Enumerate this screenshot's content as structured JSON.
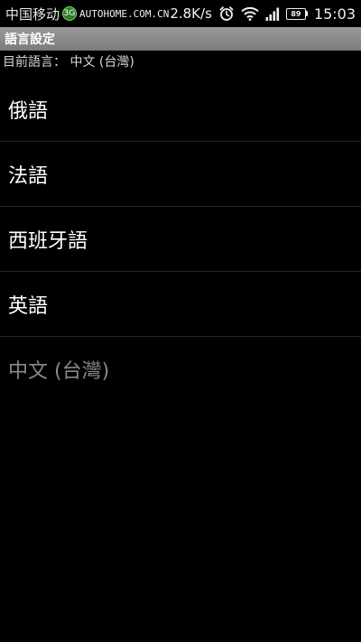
{
  "status_bar": {
    "carrier": "中国移动",
    "carrier_badge": "3G",
    "watermark": "AUTOHOME.COM.CN",
    "network_speed": "2.8K/s",
    "battery_level": "89",
    "time": "15:03",
    "icons": [
      "alarm-clock-icon",
      "wifi-icon",
      "signal-bars-icon",
      "battery-icon"
    ]
  },
  "title_bar": {
    "title": "語言設定"
  },
  "current_language": {
    "text": "目前語言： 中文 (台灣)"
  },
  "languages": [
    {
      "label": "俄語",
      "enabled": true
    },
    {
      "label": "法語",
      "enabled": true
    },
    {
      "label": "西班牙語",
      "enabled": true
    },
    {
      "label": "英語",
      "enabled": true
    },
    {
      "label": "中文 (台灣)",
      "enabled": false
    }
  ],
  "colors": {
    "background": "#000000",
    "title_bar": "#8a8a8a",
    "disabled_text": "#8a8a8a",
    "divider": "#262626"
  }
}
